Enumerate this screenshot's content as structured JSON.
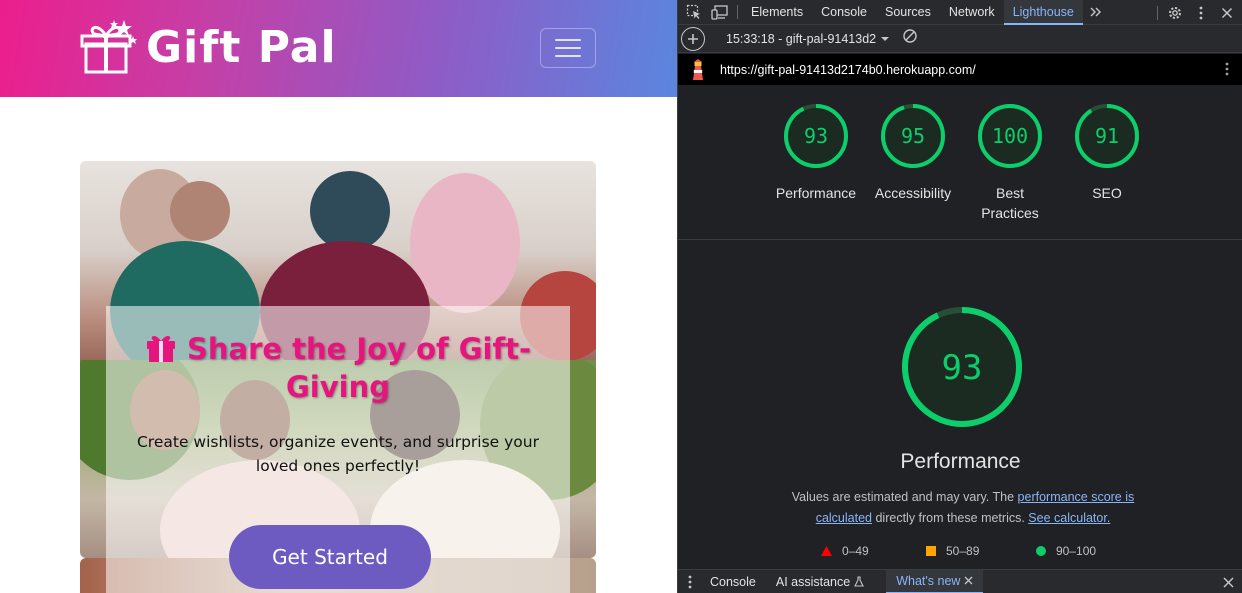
{
  "site": {
    "brand": "Gift Pal",
    "hero": {
      "title": "Share the Joy of Gift-Giving",
      "subtitle": "Create wishlists, organize events, and surprise your loved ones perfectly!",
      "cta": "Get Started"
    },
    "colors": {
      "nav_start": "#ec1e8c",
      "nav_end": "#5a86df",
      "title": "#e6157e",
      "cta": "#6e5bc2"
    }
  },
  "devtools": {
    "tabs": [
      "Elements",
      "Console",
      "Sources",
      "Network",
      "Lighthouse"
    ],
    "active_tab": "Lighthouse",
    "report_selector": "15:33:18 - gift-pal-91413d2",
    "url": "https://gift-pal-91413d2174b0.herokuapp.com/",
    "scores": [
      {
        "value": "93",
        "label": "Performance"
      },
      {
        "value": "95",
        "label": "Accessibility"
      },
      {
        "value": "100",
        "label": "Best Practices"
      },
      {
        "value": "91",
        "label": "SEO"
      }
    ],
    "main_score": {
      "value": "93",
      "label": "Performance"
    },
    "disclaimer": {
      "prefix": "Values are estimated and may vary. The ",
      "link1": "performance score is calculated",
      "middle": " directly from these metrics. ",
      "link2": "See calculator."
    },
    "legend": [
      {
        "range": "0–49",
        "shape": "triangle",
        "color": "#ff0000"
      },
      {
        "range": "50–89",
        "shape": "square",
        "color": "#ffa400"
      },
      {
        "range": "90–100",
        "shape": "circle",
        "color": "#0cce6b"
      }
    ],
    "drawer_tabs": [
      {
        "label": "Console"
      },
      {
        "label": "AI assistance"
      },
      {
        "label": "What's new"
      }
    ],
    "colors": {
      "pass": "#0cce6b",
      "link": "#8ab4f8",
      "panel": "#202124"
    }
  }
}
